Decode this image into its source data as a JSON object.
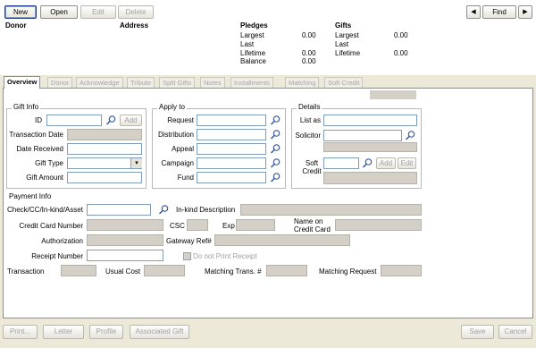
{
  "toolbar": {
    "new_label": "New",
    "open_label": "Open",
    "edit_label": "Edit",
    "delete_label": "Delete",
    "find_label": "Find",
    "prev_label": "◀",
    "next_label": "▶"
  },
  "header": {
    "donor_label": "Donor",
    "address_label": "Address",
    "pledges": {
      "title": "Pledges",
      "largest_label": "Largest",
      "largest_value": "0.00",
      "last_label": "Last",
      "lifetime_label": "Lifetime",
      "lifetime_value": "0.00",
      "balance_label": "Balance",
      "balance_value": "0.00"
    },
    "gifts": {
      "title": "Gifts",
      "largest_label": "Largest",
      "largest_value": "0.00",
      "last_label": "Last",
      "lifetime_label": "Lifetime",
      "lifetime_value": "0.00"
    }
  },
  "tabs": [
    "Overview",
    "Donor",
    "Acknowledge",
    "Tribute",
    "Split Gifts",
    "Notes",
    "Installments",
    "Matching",
    "Soft Credit"
  ],
  "gift_info": {
    "title": "Gift Info",
    "id_label": "ID",
    "add_label": "Add",
    "transaction_date_label": "Transaction Date",
    "date_received_label": "Date Received",
    "gift_type_label": "Gift Type",
    "gift_amount_label": "Gift Amount"
  },
  "apply_to": {
    "title": "Apply to",
    "request_label": "Request",
    "distribution_label": "Distribution",
    "appeal_label": "Appeal",
    "campaign_label": "Campaign",
    "fund_label": "Fund"
  },
  "details": {
    "title": "Details",
    "list_as_label": "List as",
    "solicitor_label": "Solicitor",
    "soft_credit_label": "Soft\nCredit",
    "add_label": "Add",
    "edit_label": "Edit"
  },
  "payment": {
    "title": "Payment Info",
    "check_label": "Check/CC/In-kind/Asset",
    "inkind_label": "In-kind Description",
    "cc_number_label": "Credit Card Number",
    "csc_label": "CSC",
    "exp_label": "Exp",
    "name_on_card_label": "Name on\nCredit Card",
    "authorization_label": "Authorization",
    "gateway_label": "Gateway Ref#",
    "receipt_number_label": "Receipt Number",
    "no_receipt_label": "Do not Print Receipt",
    "transaction_label": "Transaction",
    "usual_cost_label": "Usual Cost",
    "matching_trans_label": "Matching Trans. #",
    "matching_request_label": "Matching Request"
  },
  "footer": {
    "print_label": "Print...",
    "letter_label": "Letter",
    "profile_label": "Profile",
    "associated_gift_label": "Associated Gift",
    "save_label": "Save",
    "cancel_label": "Cancel"
  }
}
